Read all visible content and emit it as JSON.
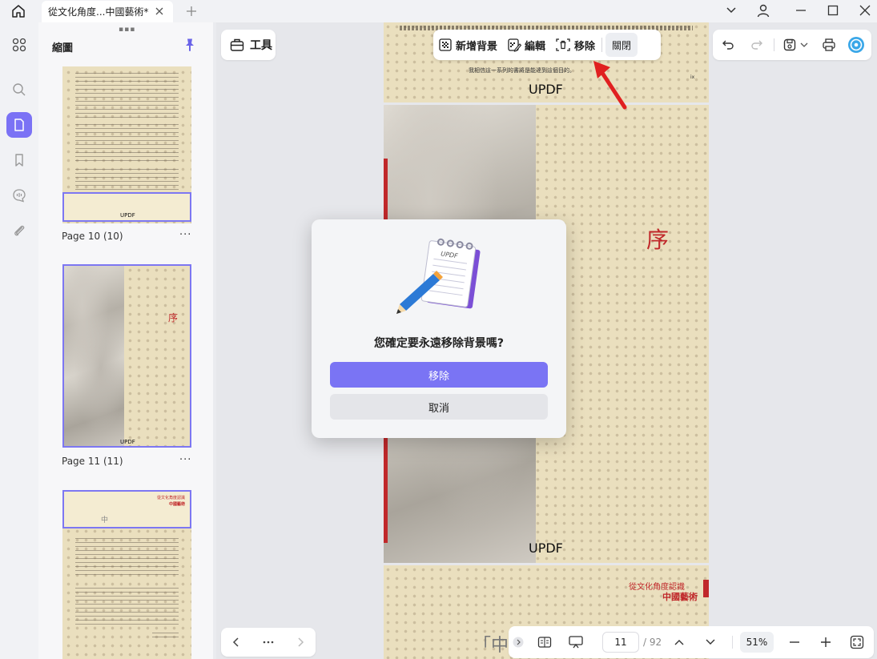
{
  "titlebar": {
    "tab_title": "從文化角度...中國藝術*"
  },
  "thumbnails": {
    "title": "縮圖",
    "pages": [
      {
        "label": "Page 10 (10)",
        "footer": "UPDF"
      },
      {
        "label": "Page 11 (11)",
        "footer": "UPDF",
        "heading": "序"
      },
      {
        "subtitle": "從文化角度認識",
        "heading": "中國藝術",
        "char": "中"
      }
    ],
    "more": "···"
  },
  "toolbar": {
    "tools_label": "工具"
  },
  "background_toolbar": {
    "add_label": "新增背景",
    "edit_label": "編輯",
    "remove_label": "移除",
    "close_label": "關閉"
  },
  "document": {
    "top_sentence": "我相信這一系列的書將是能達到這個目的。",
    "top_page_numeral": "ix",
    "updf_top": "UPDF",
    "xu_char": "序",
    "updf_mid": "UPDF",
    "bottom_subtitle": "從文化角度認識",
    "bottom_title": "中國藝術",
    "bottom_char": "「中"
  },
  "statusbar": {
    "current_page": "11",
    "total_pages": "/ 92",
    "zoom": "51%"
  },
  "modal": {
    "message": "您確定要永遠移除背景嗎?",
    "confirm_label": "移除",
    "cancel_label": "取消"
  },
  "colors": {
    "accent": "#7b72f5",
    "red_mark": "#c0282a",
    "paper": "#eadfbe"
  }
}
